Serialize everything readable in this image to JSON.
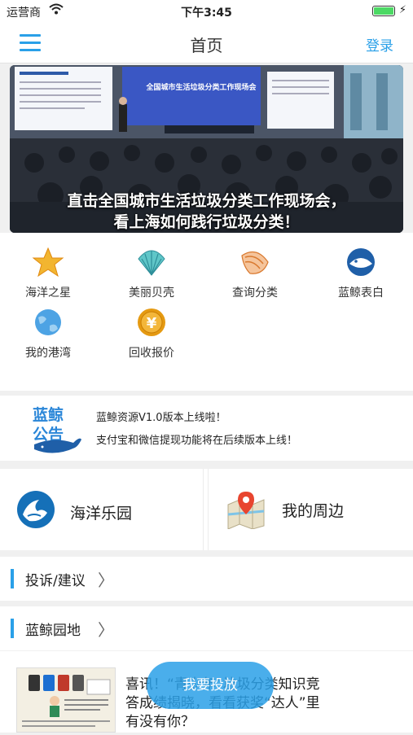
{
  "status_bar": {
    "carrier": "运营商",
    "time": "下午3:45"
  },
  "nav": {
    "title": "首页",
    "login": "登录"
  },
  "banner": {
    "screen_title": "全国城市生活垃圾分类工作现场会",
    "caption_line1": "直击全国城市生活垃圾分类工作现场会，",
    "caption_line2": "看上海如何践行垃圾分类！"
  },
  "quick_menu": [
    {
      "label": "海洋之星",
      "icon": "starfish-icon"
    },
    {
      "label": "美丽贝壳",
      "icon": "seashell-icon"
    },
    {
      "label": "查询分类",
      "icon": "conch-icon"
    },
    {
      "label": "蓝鲸表白",
      "icon": "whale-icon"
    },
    {
      "label": "我的港湾",
      "icon": "globe-icon"
    },
    {
      "label": "回收报价",
      "icon": "coin-icon"
    }
  ],
  "notice": {
    "logo_text": "蓝鲸公告",
    "line1": "蓝鲸资源V1.0版本上线啦！",
    "line2": "支付宝和微信提现功能将在后续版本上线！"
  },
  "cards": [
    {
      "label": "海洋乐园",
      "icon": "ocean-wave-icon"
    },
    {
      "label": "我的周边",
      "icon": "map-pin-icon"
    }
  ],
  "sections": [
    {
      "title": "投诉/建议"
    },
    {
      "title": "蓝鲸园地"
    }
  ],
  "news": {
    "text": "喜讯！“青少年”垃圾分类知识竞答成绩揭晓，看看获奖“达人”里有没有你？"
  },
  "fab": {
    "label": "我要投放"
  },
  "colors": {
    "accent": "#2aa0e8",
    "battery": "#4cd964"
  }
}
